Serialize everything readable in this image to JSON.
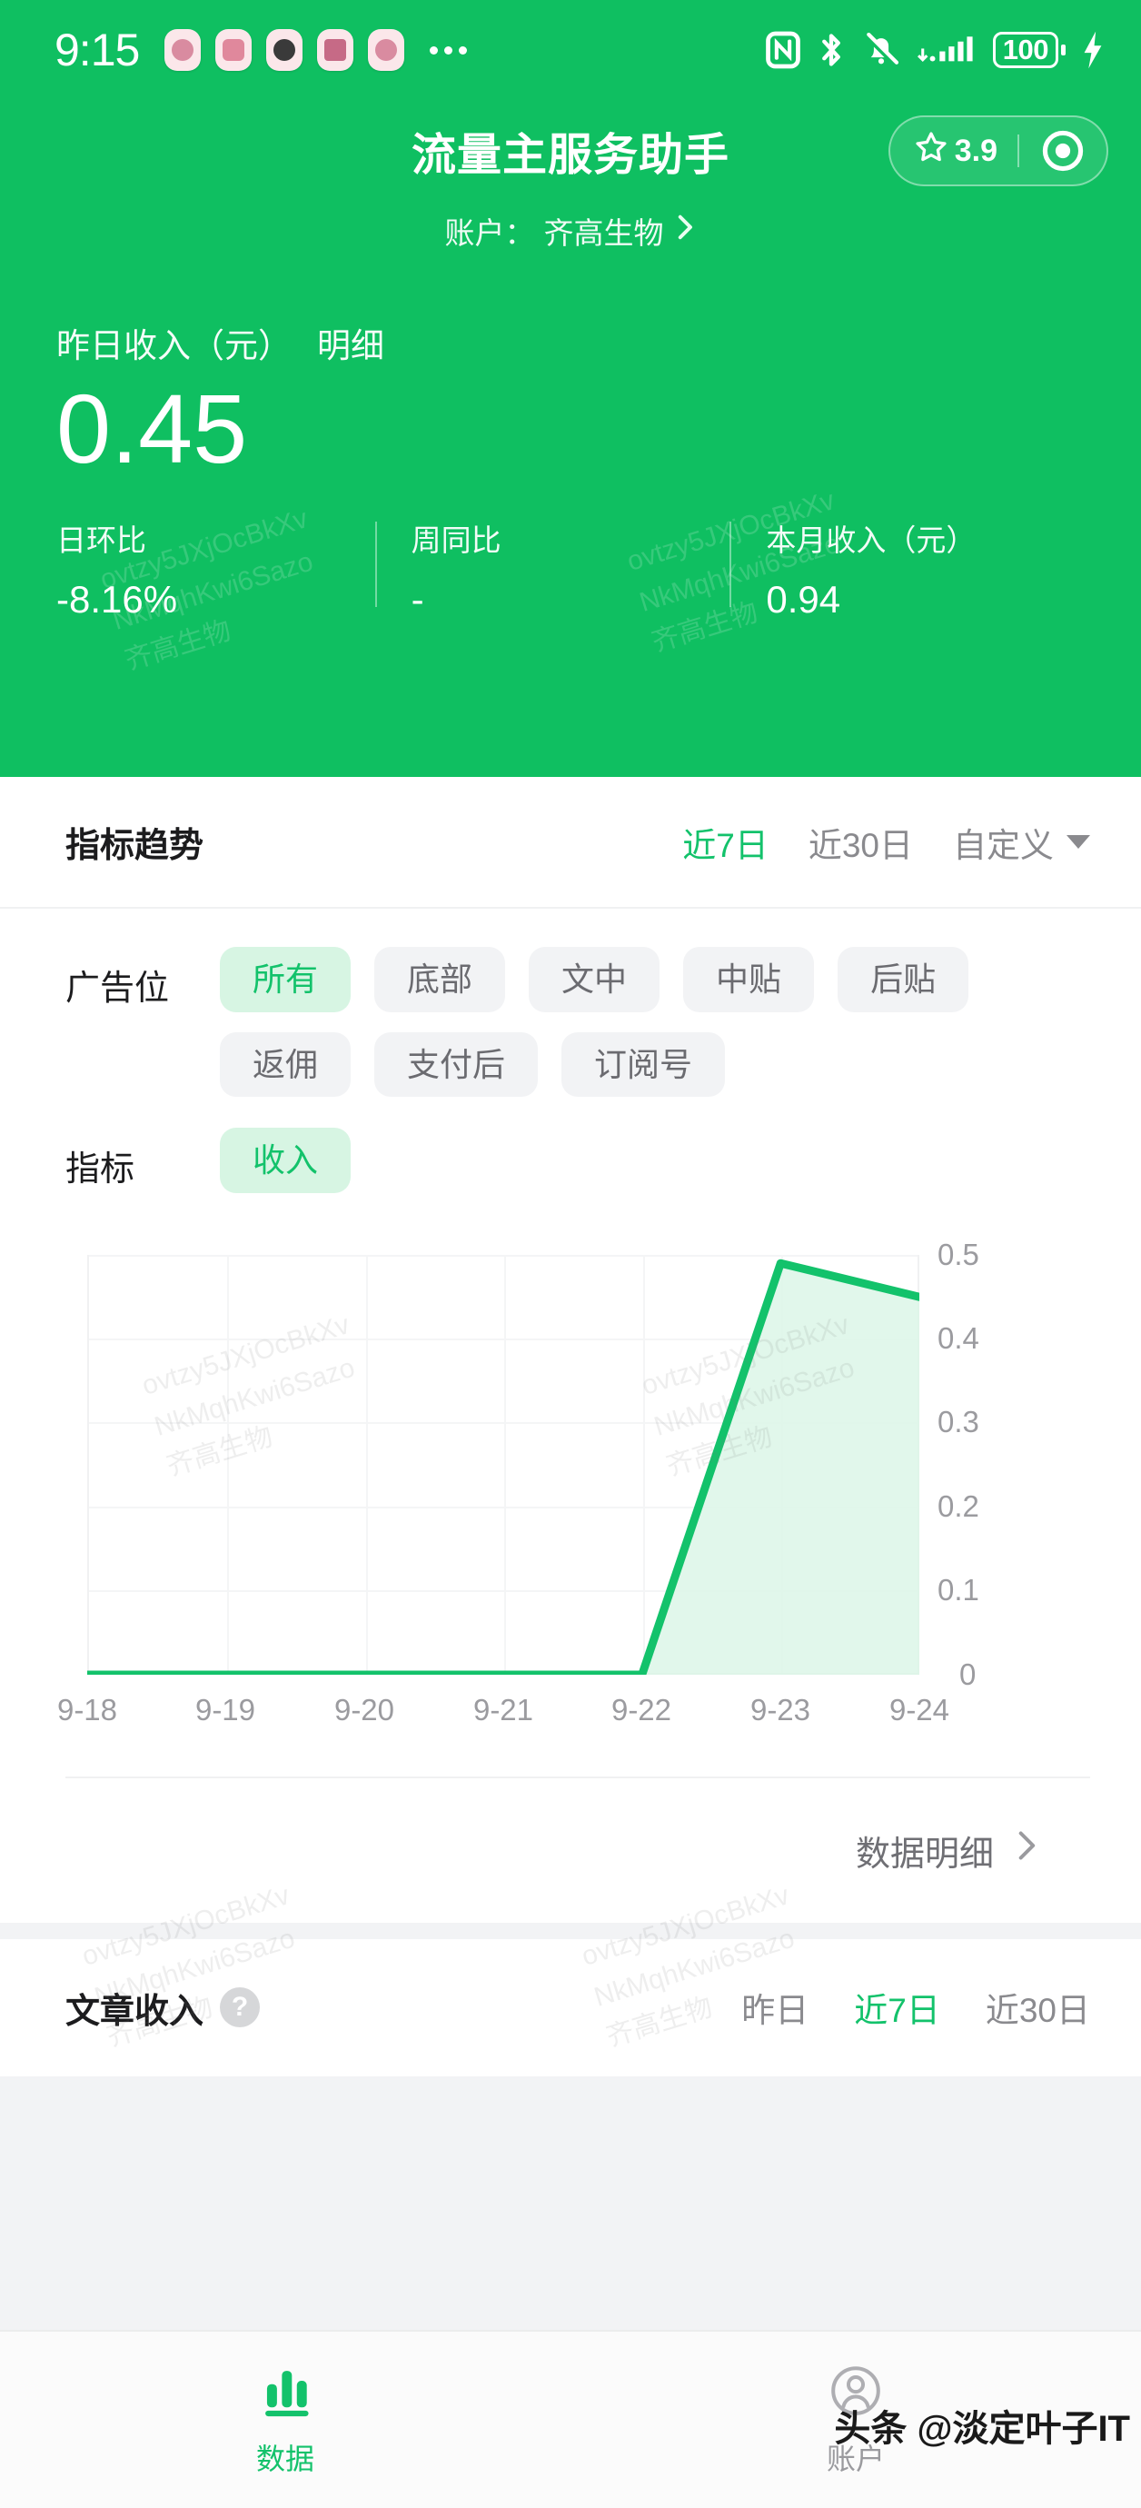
{
  "status_bar": {
    "time": "9:15",
    "notification_icons": [
      "tiktok-icon",
      "app-icon-2",
      "app-icon-3",
      "app-icon-4",
      "app-icon-5"
    ],
    "overflow_icon": "more-dots-icon",
    "right_icons": [
      "nfc-icon",
      "bluetooth-icon",
      "mute-bell-icon",
      "signal-bars-icon"
    ],
    "battery_level": "100",
    "charging_icon": "charging-bolt-icon"
  },
  "header": {
    "app_title": "流量主服务助手",
    "rating": "3.9",
    "star_icon": "star-icon",
    "capsule_menu_icon": "target-circle-icon",
    "account_label": "账户：",
    "account_name": "齐高生物",
    "account_chevron_icon": "chevron-right-icon",
    "income_label": "昨日收入（元）",
    "income_detail_link": "明细",
    "income_value": "0.45",
    "stats": [
      {
        "label": "日环比",
        "value": "-8.16%"
      },
      {
        "label": "周同比",
        "value": "-"
      },
      {
        "label": "本月收入（元）",
        "value": "0.94"
      }
    ]
  },
  "trend": {
    "title": "指标趋势",
    "tabs": [
      {
        "label": "近7日",
        "active": true
      },
      {
        "label": "近30日",
        "active": false
      },
      {
        "label": "自定义",
        "active": false
      }
    ],
    "custom_caret_icon": "chevron-down-icon",
    "ad_slot_label": "广告位",
    "ad_slots": [
      {
        "label": "所有",
        "active": true
      },
      {
        "label": "底部",
        "active": false
      },
      {
        "label": "文中",
        "active": false
      },
      {
        "label": "中贴",
        "active": false
      },
      {
        "label": "后贴",
        "active": false
      },
      {
        "label": "返佣",
        "active": false
      },
      {
        "label": "支付后",
        "active": false
      },
      {
        "label": "订阅号",
        "active": false
      }
    ],
    "metric_label": "指标",
    "metrics": [
      {
        "label": "收入",
        "active": true
      }
    ],
    "detail_link": "数据明细",
    "detail_chevron_icon": "chevron-right-icon"
  },
  "chart_data": {
    "type": "area",
    "title": "",
    "xlabel": "",
    "ylabel": "",
    "categories": [
      "9-18",
      "9-19",
      "9-20",
      "9-21",
      "9-22",
      "9-23",
      "9-24"
    ],
    "values": [
      0,
      0,
      0,
      0,
      0,
      0.49,
      0.45
    ],
    "series": [
      {
        "name": "收入",
        "values": [
          0,
          0,
          0,
          0,
          0,
          0.49,
          0.45
        ]
      }
    ],
    "ylim": [
      0,
      0.5
    ],
    "yticks": [
      "0.5",
      "0.4",
      "0.3",
      "0.2",
      "0.1",
      "0"
    ],
    "ytick_values": [
      0.5,
      0.4,
      0.3,
      0.2,
      0.1,
      0
    ],
    "grid": true,
    "legend": "none",
    "line_color": "#13c26b",
    "fill_color": "#d9f5e5"
  },
  "article": {
    "title": "文章收入",
    "help_icon": "question-mark-icon",
    "help_label": "?",
    "tabs": [
      {
        "label": "昨日",
        "active": false
      },
      {
        "label": "近7日",
        "active": true
      },
      {
        "label": "近30日",
        "active": false
      }
    ]
  },
  "tabbar": {
    "items": [
      {
        "label": "数据",
        "icon": "bar-chart-icon",
        "active": true
      },
      {
        "label": "账户",
        "icon": "person-icon",
        "active": false
      }
    ]
  },
  "watermarks": {
    "line1": "ovtzy5JXjOcBkXv",
    "line2": "NkMqhKwi6Sazo",
    "line3": "齐高生物",
    "corner": "头条 @淡定叶子IT"
  },
  "colors": {
    "brand_green": "#0fbf61",
    "accent_green": "#13c26b",
    "chip_bg": "#f2f3f5",
    "chip_active_bg": "#d7f5e3",
    "page_bg": "#f2f3f5"
  }
}
